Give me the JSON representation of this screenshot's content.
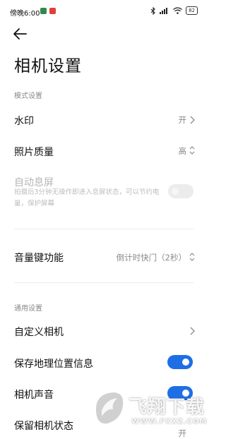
{
  "status_bar": {
    "time": "傍晚6:00",
    "battery": "82"
  },
  "page": {
    "title": "相机设置"
  },
  "sections": {
    "mode": {
      "header": "模式设置",
      "watermark": {
        "label": "水印",
        "value": "开"
      },
      "photo_quality": {
        "label": "照片质量",
        "value": "高"
      },
      "auto_screen_off": {
        "label": "自动息屏",
        "description": "拍摄后3分钟无操作即进入息屏状态，可以节约电量，保护屏幕",
        "enabled": false,
        "disabled": true
      },
      "volume_key": {
        "label": "音量键功能",
        "value": "倒计时快门（2秒）"
      }
    },
    "general": {
      "header": "通用设置",
      "custom_camera": {
        "label": "自定义相机"
      },
      "save_location": {
        "label": "保存地理位置信息",
        "enabled": true
      },
      "camera_sound": {
        "label": "相机声音",
        "enabled": true
      },
      "keep_state": {
        "label": "保留相机状态",
        "value": "开"
      }
    }
  },
  "watermark_overlay": {
    "text_cn": "飞翔下载",
    "text_url": "WWW.FXXZ.COM"
  },
  "colors": {
    "accent": "#1e6fe6",
    "toggle_off": "#ececec",
    "muted": "#8a8a8a"
  }
}
